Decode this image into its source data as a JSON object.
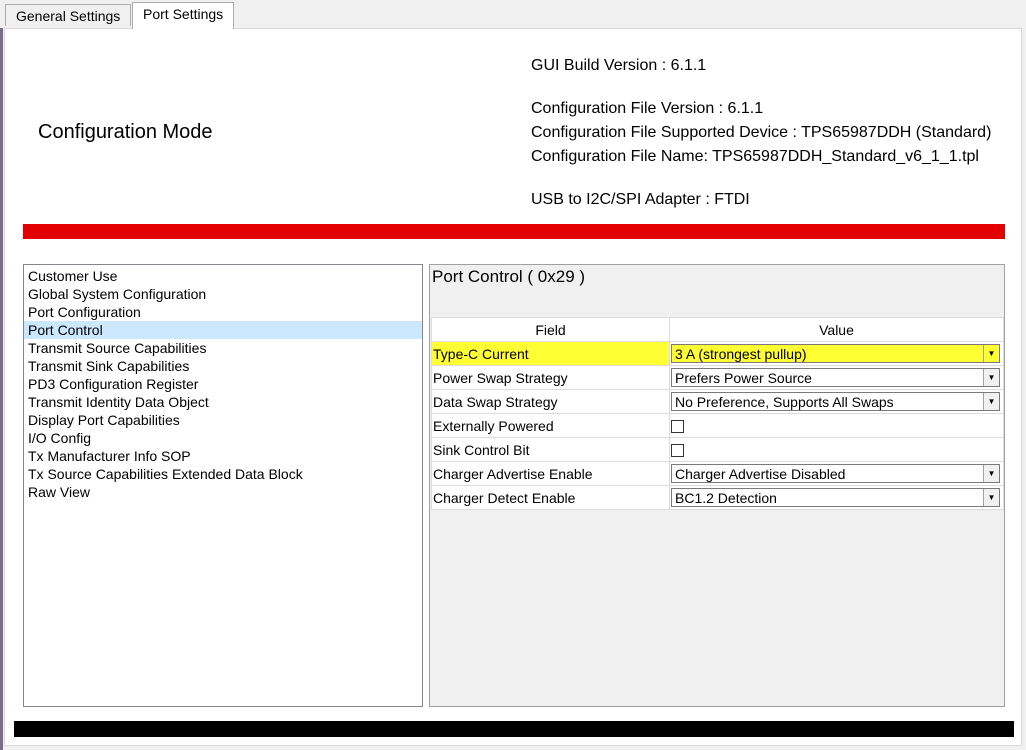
{
  "tabs": [
    {
      "label": "General Settings",
      "active": false
    },
    {
      "label": "Port Settings",
      "active": true
    }
  ],
  "header": {
    "mode_title": "Configuration Mode",
    "gui_build_version": "GUI Build Version : 6.1.1",
    "config_file_version": "Configuration File Version : 6.1.1",
    "config_file_device": "Configuration File Supported Device : TPS65987DDH (Standard)",
    "config_file_name": "Configuration File Name: TPS65987DDH_Standard_v6_1_1.tpl",
    "adapter": "USB to I2C/SPI Adapter : FTDI"
  },
  "colors": {
    "accent_bar": "#e30000",
    "highlight_row": "#ffff33",
    "selected_item": "#cce8ff"
  },
  "nav": {
    "items": [
      "Customer Use",
      "Global System Configuration",
      "Port Configuration",
      "Port Control",
      "Transmit Source Capabilities",
      "Transmit Sink Capabilities",
      "PD3 Configuration Register",
      "Transmit Identity Data Object",
      "Display Port Capabilities",
      "I/O Config",
      "Tx Manufacturer Info SOP",
      "Tx Source Capabilities Extended Data Block",
      "Raw View"
    ],
    "selected": "Port Control"
  },
  "panel": {
    "title": "Port Control  ( 0x29 )",
    "headers": {
      "field": "Field",
      "value": "Value"
    },
    "rows": [
      {
        "field": "Type-C Current",
        "type": "combo",
        "value": "3 A (strongest pullup)",
        "highlighted": true
      },
      {
        "field": "Power Swap Strategy",
        "type": "combo",
        "value": "Prefers Power Source"
      },
      {
        "field": "Data Swap Strategy",
        "type": "combo",
        "value": "No Preference, Supports All Swaps"
      },
      {
        "field": "Externally Powered",
        "type": "checkbox",
        "checked": false
      },
      {
        "field": "Sink Control Bit",
        "type": "checkbox",
        "checked": false
      },
      {
        "field": "Charger Advertise Enable",
        "type": "combo",
        "value": "Charger Advertise Disabled"
      },
      {
        "field": "Charger Detect Enable",
        "type": "combo",
        "value": "BC1.2 Detection"
      }
    ]
  }
}
